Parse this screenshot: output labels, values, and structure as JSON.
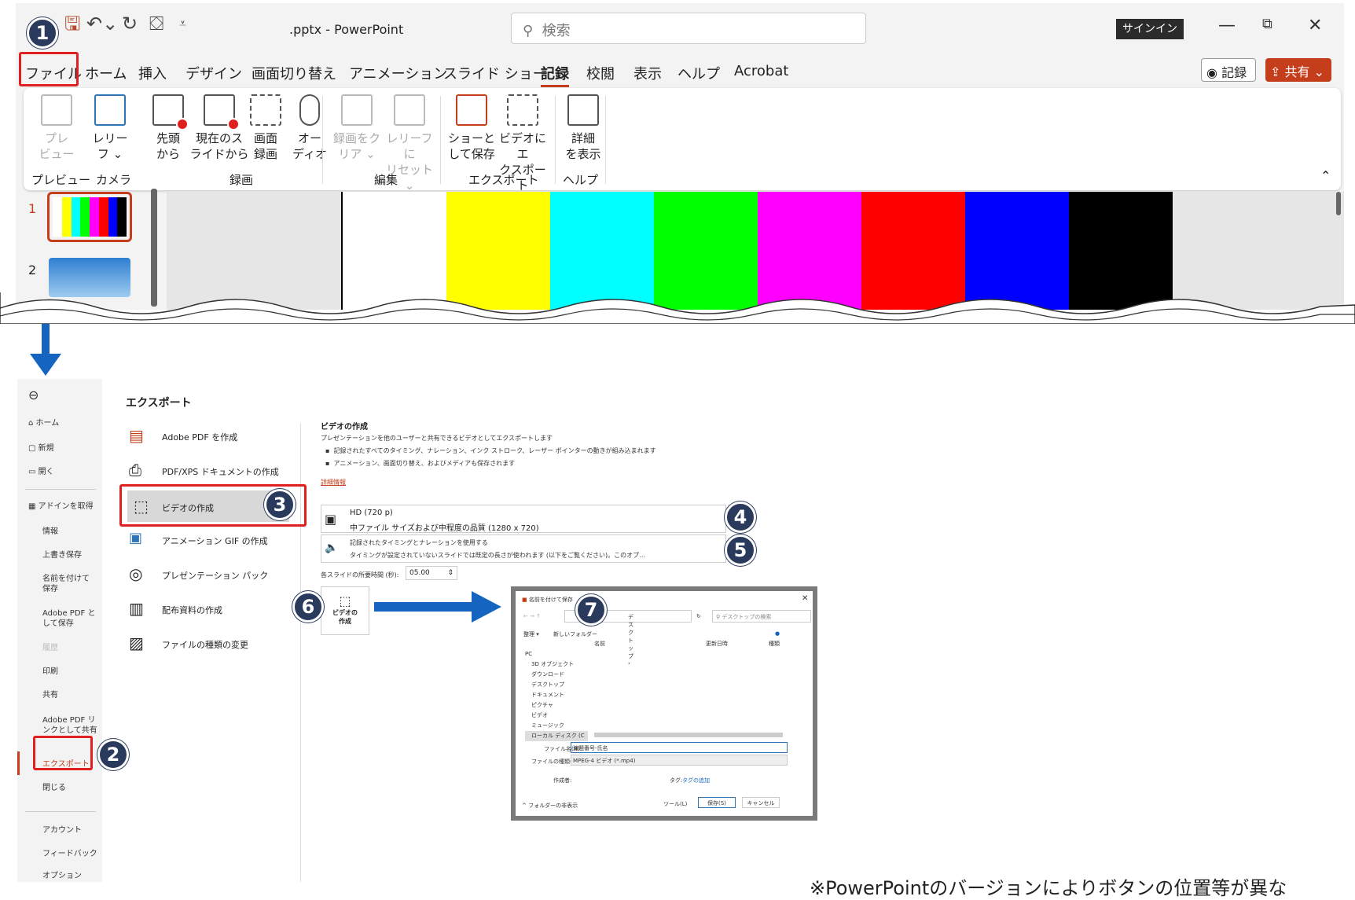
{
  "titlebar": {
    "filename": ".pptx",
    "separator": "-",
    "app": "PowerPoint",
    "search_placeholder": "検索",
    "signin": "サインイン"
  },
  "tabs": [
    "ファイル",
    "ホーム",
    "挿入",
    "デザイン",
    "画面切り替え",
    "アニメーション",
    "スライド ショー",
    "記録",
    "校閲",
    "表示",
    "ヘルプ",
    "Acrobat"
  ],
  "record_button": "記録",
  "share_button": "共有",
  "ribbon": {
    "buttons": [
      {
        "label1": "プレ",
        "label2": "ビュー",
        "disabled": true
      },
      {
        "label1": "レリー",
        "label2": "フ ⌄",
        "disabled": false
      },
      {
        "label1": "先頭",
        "label2": "から",
        "disabled": false
      },
      {
        "label1": "現在のス",
        "label2": "ライドから",
        "disabled": false
      },
      {
        "label1": "画面",
        "label2": "録画",
        "disabled": false
      },
      {
        "label1": "オー",
        "label2": "ディオ",
        "disabled": false
      },
      {
        "label1": "録画をク",
        "label2": "リア ⌄",
        "disabled": true
      },
      {
        "label1": "レリーフに",
        "label2": "リセット ⌄",
        "disabled": true
      },
      {
        "label1": "ショーと",
        "label2": "して保存",
        "disabled": false
      },
      {
        "label1": "ビデオにエ",
        "label2": "クスポート",
        "disabled": false
      },
      {
        "label1": "詳細",
        "label2": "を表示",
        "disabled": false
      }
    ],
    "groups": [
      "プレビュー",
      "カメラ",
      "録画",
      "編集",
      "エクスポート",
      "ヘルプ"
    ]
  },
  "slides": [
    "1",
    "2"
  ],
  "color_bars": [
    "#ffffff",
    "#ffff00",
    "#00ffff",
    "#00ff00",
    "#ff00ff",
    "#ff0000",
    "#0000ff",
    "#000000"
  ],
  "backstage": {
    "nav": [
      "ホーム",
      "新規",
      "開く",
      "アドインを取得",
      "情報",
      "上書き保存",
      "名前を付けて保存",
      "Adobe PDF として保存",
      "履歴",
      "印刷",
      "共有",
      "Adobe PDF リンクとして共有",
      "エクスポート",
      "閉じる",
      "アカウント",
      "フィードバック",
      "オプション"
    ],
    "title": "エクスポート",
    "export_items": [
      "Adobe PDF を作成",
      "PDF/XPS ドキュメントの作成",
      "ビデオの作成",
      "アニメーション GIF の作成",
      "プレゼンテーション パック",
      "配布資料の作成",
      "ファイルの種類の変更"
    ],
    "video": {
      "heading": "ビデオの作成",
      "desc": "プレゼンテーションを他のユーザーと共有できるビデオとしてエクスポートします",
      "bullet1": "記録されたすべてのタイミング、ナレーション、インク ストローク、レーザー ポインターの動きが組み込まれます",
      "bullet2": "アニメーション、画面切り替え、およびメディアも保存されます",
      "link": "詳細情報",
      "quality_title": "HD (720 p)",
      "quality_desc": "中ファイル サイズおよび中程度の品質 (1280 x 720)",
      "timing_title": "記録されたタイミングとナレーションを使用する",
      "timing_desc": "タイミングが設定されていないスライドでは既定の長さが使われます (以下をご覧ください)。このオプ…",
      "seconds_label": "各スライドの所要時間 (秒):",
      "seconds_value": "05.00",
      "create_label1": "ビデオの",
      "create_label2": "作成"
    }
  },
  "dialog": {
    "title": "名前を付けて保存",
    "path": "デスクトップ ›",
    "search": "デスクトップの検索",
    "organize": "整理 ▾",
    "new_folder": "新しいフォルダー",
    "col_name": "名前",
    "col_date": "更新日時",
    "col_type": "種類",
    "tree": [
      "PC",
      "3D オブジェクト",
      "ダウンロード",
      "デスクトップ",
      "ドキュメント",
      "ピクチャ",
      "ビデオ",
      "ミュージック",
      "ローカル ディスク (C"
    ],
    "filename_label": "ファイル名(N):",
    "filename_value": "演題番号-氏名",
    "filetype_label": "ファイルの種類(T):",
    "filetype_value": "MPEG-4 ビデオ (*.mp4)",
    "author_label": "作成者:",
    "tags_label": "タグ:",
    "tags_value": "タグの追加",
    "hide_folders": "フォルダーの非表示",
    "tools": "ツール(L)",
    "save": "保存(S)",
    "cancel": "キャンセル"
  },
  "badges": [
    "1",
    "2",
    "3",
    "4",
    "5",
    "6",
    "7"
  ],
  "note": "※PowerPointのバージョンによりボタンの位置等が異な"
}
